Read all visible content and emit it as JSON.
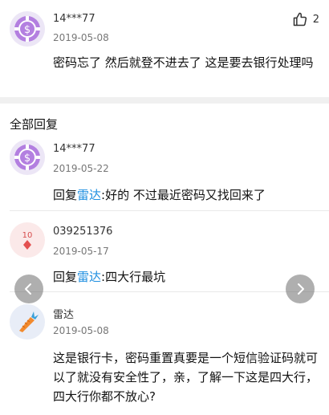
{
  "top_comment": {
    "user": "14***77",
    "date": "2019-05-08",
    "like_count": "2",
    "text": "密码忘了 然后就登不进去了 这是要去银行处理吗"
  },
  "replies_section": {
    "title": "全部回复"
  },
  "replies": [
    {
      "user": "14***77",
      "date": "2019-05-22",
      "reply_prefix": "回复",
      "reply_to": "雷达",
      "text": ":好的 不过最近密码又找回来了",
      "avatar_icon": "poker-chip-icon"
    },
    {
      "user": "039251376",
      "date": "2019-05-17",
      "reply_prefix": "回复",
      "reply_to": "雷达",
      "text": ":四大行最坑",
      "avatar_icon": "playing-card-icon",
      "avatar_card_label": "10"
    },
    {
      "user": "雷达",
      "date": "2019-05-08",
      "text": "这是银行卡，密码重置真要是一个短信验证码就可以了就没有安全性了，亲，了解一下这是四大行，四大行你都不放心?",
      "avatar_icon": "carrot-icon"
    }
  ],
  "colors": {
    "link": "#1f8fe0",
    "chip_purple": "#a874d8",
    "card_red": "#e35050",
    "carrot_orange": "#f28a2e"
  }
}
